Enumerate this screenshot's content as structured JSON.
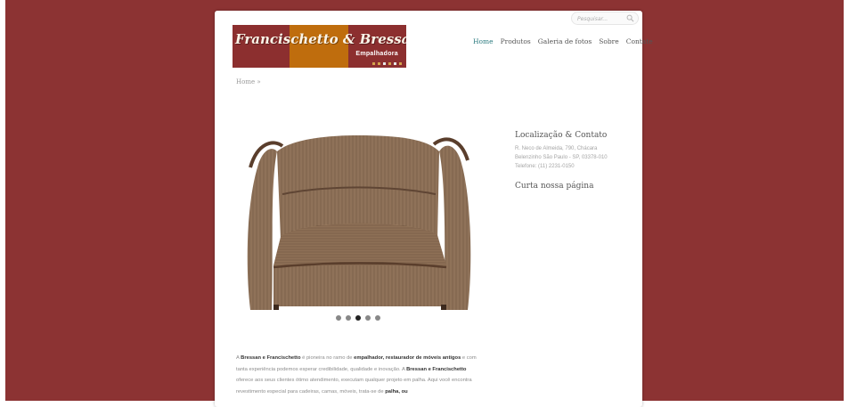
{
  "search": {
    "placeholder": "Pesquisar..."
  },
  "logo": {
    "name": "Francischetto & Bressan",
    "subtitle": "Empalhadora",
    "dot_colors": [
      "#d4a24c",
      "#d4a24c",
      "#e6e6e6",
      "#d4a24c",
      "#e6e6e6",
      "#d4a24c"
    ]
  },
  "nav": {
    "items": [
      {
        "label": "Home",
        "active": true
      },
      {
        "label": "Produtos"
      },
      {
        "label": "Galeria de fotos"
      },
      {
        "label": "Sobre"
      },
      {
        "label": "Contate"
      }
    ]
  },
  "breadcrumb": "Home »",
  "slider": {
    "slide_count": 5,
    "active_index": 2
  },
  "sidebar": {
    "contact_title": "Localização & Contato",
    "address": [
      "R. Neco de Almeida, 790, Chácara",
      "Belenzinho São Paulo - SP, 03378-010",
      "Telefone: (11) 2231-0150"
    ],
    "like_title": "Curta nossa página"
  },
  "content": {
    "p1": "A ",
    "b1": "Bressan e Francischetto",
    "p2": " é pioneira no ramo de ",
    "b2": "empalhador, restaurador de móveis antigos",
    "p3": " e com tanta experiência podemos esperar credibilidade, qualidade e inovação. A ",
    "b3": "Bressan e Francischetto",
    "p4": " oferece aos seus clientes ótimo atendimento, executam qualquer projeto em palha. Aqui você encontra revestimento especial para cadeiras, camas, móveis, trata-se de ",
    "b4": "palha, ou"
  },
  "colors": {
    "background": "#8c3333",
    "logo_red": "#8c2f2f",
    "logo_orange": "#bf6d0d",
    "nav_active": "#2a7a7e"
  }
}
